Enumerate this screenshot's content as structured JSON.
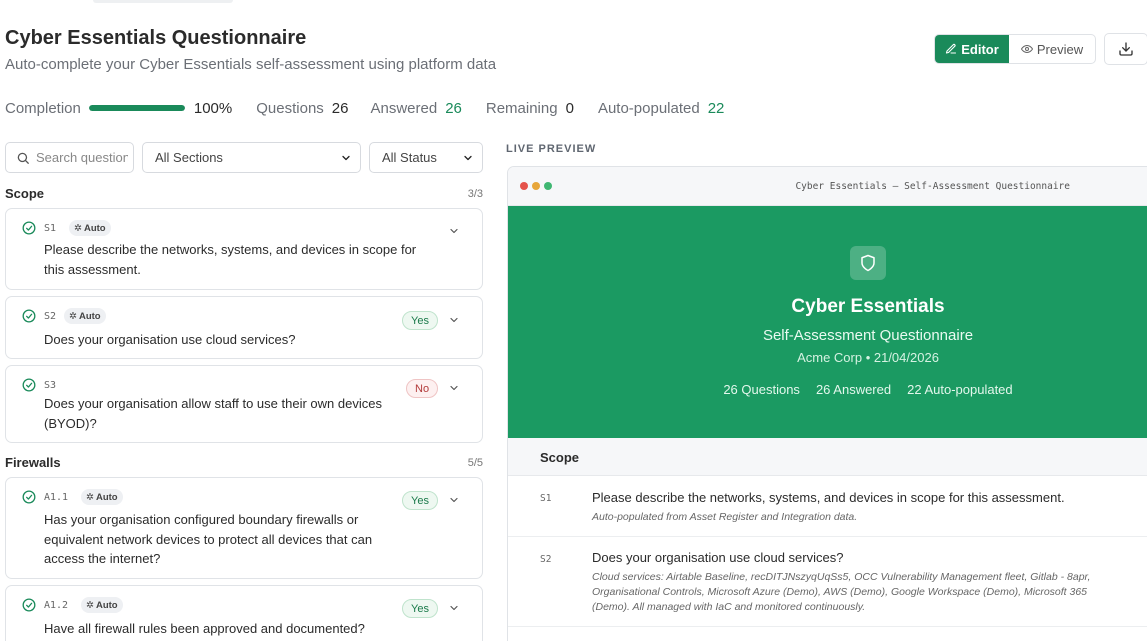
{
  "header": {
    "title": "Cyber Essentials Questionnaire",
    "subtitle": "Auto-complete your Cyber Essentials self-assessment using platform data",
    "editor_label": "Editor",
    "preview_label": "Preview",
    "download_icon": "download-icon"
  },
  "stats": {
    "completion_label": "Completion",
    "completion_value": "100%",
    "completion_fraction": 1.0,
    "questions_label": "Questions",
    "questions_value": "26",
    "answered_label": "Answered",
    "answered_value": "26",
    "remaining_label": "Remaining",
    "remaining_value": "0",
    "autopop_label": "Auto-populated",
    "autopop_value": "22"
  },
  "filters": {
    "search_placeholder": "Search questions",
    "section_selected": "All Sections",
    "status_selected": "All Status"
  },
  "sections": [
    {
      "title": "Scope",
      "count": "3/3",
      "questions": [
        {
          "id": "S1",
          "auto": "Auto",
          "text": "Please describe the networks, systems, and devices in scope for this assessment.",
          "answer": ""
        },
        {
          "id": "S2",
          "auto": "Auto",
          "text": "Does your organisation use cloud services?",
          "answer": "Yes"
        },
        {
          "id": "S3",
          "auto": "",
          "text": "Does your organisation allow staff to use their own devices (BYOD)?",
          "answer": "No"
        }
      ]
    },
    {
      "title": "Firewalls",
      "count": "5/5",
      "questions": [
        {
          "id": "A1.1",
          "auto": "Auto",
          "text": "Has your organisation configured boundary firewalls or equivalent network devices to protect all devices that can access the internet?",
          "answer": "Yes"
        },
        {
          "id": "A1.2",
          "auto": "Auto",
          "text": "Have all firewall rules been approved and documented?",
          "answer": "Yes"
        }
      ]
    }
  ],
  "preview": {
    "label": "LIVE PREVIEW",
    "window_title": "Cyber Essentials — Self-Assessment Questionnaire",
    "hero_title": "Cyber Essentials",
    "hero_subtitle": "Self-Assessment Questionnaire",
    "hero_meta": "Acme Corp • 21/04/2026",
    "hero_questions": "26 Questions",
    "hero_answered": "26 Answered",
    "hero_autopop": "22 Auto-populated",
    "section_title": "Scope",
    "rows": [
      {
        "id": "S1",
        "question": "Please describe the networks, systems, and devices in scope for this assessment.",
        "answer": "Auto-populated from Asset Register and Integration data."
      },
      {
        "id": "S2",
        "question": "Does your organisation use cloud services?",
        "answer": "Cloud services: Airtable Baseline, recDITJNszyqUqSs5, OCC Vulnerability Management fleet, Gitlab - 8apr, Organisational Controls, Microsoft Azure (Demo), AWS (Demo), Google Workspace (Demo), Microsoft 365 (Demo). All managed with IaC and monitored continuously."
      }
    ]
  },
  "colors": {
    "accent": "#1a8a5a",
    "hero": "#1b9a62",
    "yes": "#1a7a4a",
    "no": "#b23a3a"
  }
}
